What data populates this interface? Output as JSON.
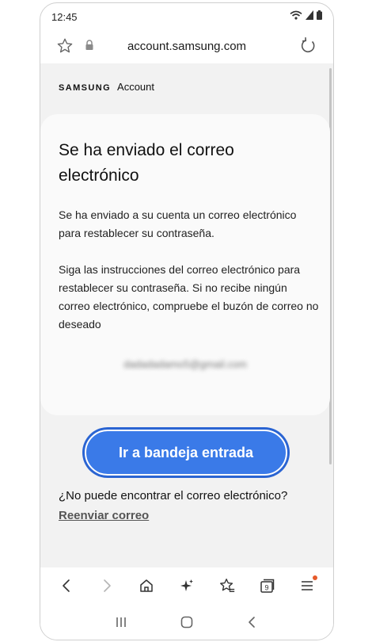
{
  "status_bar": {
    "time": "12:45"
  },
  "browser": {
    "url": "account.samsung.com"
  },
  "brand": {
    "logo": "SAMSUNG",
    "product": "Account"
  },
  "card": {
    "title": "Se ha enviado el correo electrónico",
    "paragraph1": "Se ha enviado a su cuenta un correo electrónico para restablecer su contraseña.",
    "paragraph2": "Siga las instrucciones del correo electrónico para restablecer su contraseña. Si no recibe ningún correo electrónico, compruebe el buzón de correo no deseado",
    "email": "dadadadamo5@gmail.com"
  },
  "actions": {
    "inbox_button": "Ir a bandeja entrada",
    "help_question": "¿No puede encontrar el correo electrónico?",
    "resend_link": "Reenviar correo"
  },
  "browser_nav": {
    "tab_count": "9",
    "icons": [
      "back-icon",
      "forward-icon",
      "home-icon",
      "sparkle-icon",
      "bookmarks-icon",
      "tabs-icon",
      "menu-icon"
    ]
  },
  "colors": {
    "primary": "#3a7ae8",
    "primary_border": "#2a64d2",
    "page_bg": "#f2f2f2",
    "card_bg": "#fafafa",
    "notification_dot": "#e65a2a"
  }
}
